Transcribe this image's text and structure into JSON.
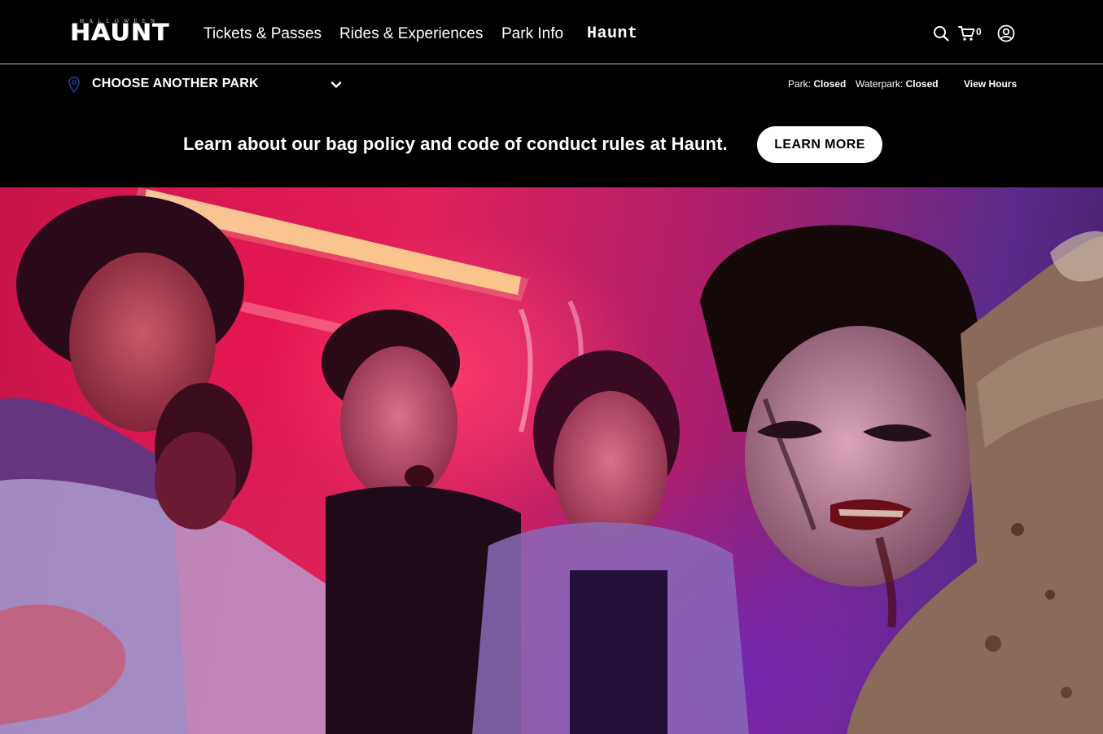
{
  "header": {
    "logo": {
      "small_text": "HALLOWEEN",
      "big_text": "HAUNT"
    },
    "nav": [
      {
        "label": "Tickets & Passes"
      },
      {
        "label": "Rides & Experiences"
      },
      {
        "label": "Park Info"
      },
      {
        "label": "Haunt"
      }
    ],
    "icons": {
      "search": "search-icon",
      "cart": "cart-icon",
      "account": "account-icon"
    },
    "cart_count": "0"
  },
  "park_bar": {
    "choose_label": "CHOOSE ANOTHER PARK",
    "park_status_label": "Park:",
    "park_status_value": "Closed",
    "waterpark_status_label": "Waterpark:",
    "waterpark_status_value": "Closed",
    "view_hours_label": "View Hours",
    "pin_color": "#1a3a8a"
  },
  "notice": {
    "text": "Learn about our bag policy and code of conduct rules at Haunt.",
    "button_label": "LEARN MORE"
  },
  "hero": {
    "palette": {
      "primary": "#d81b4f",
      "secondary": "#5a2a8a",
      "neon": "#f5e37a"
    }
  }
}
